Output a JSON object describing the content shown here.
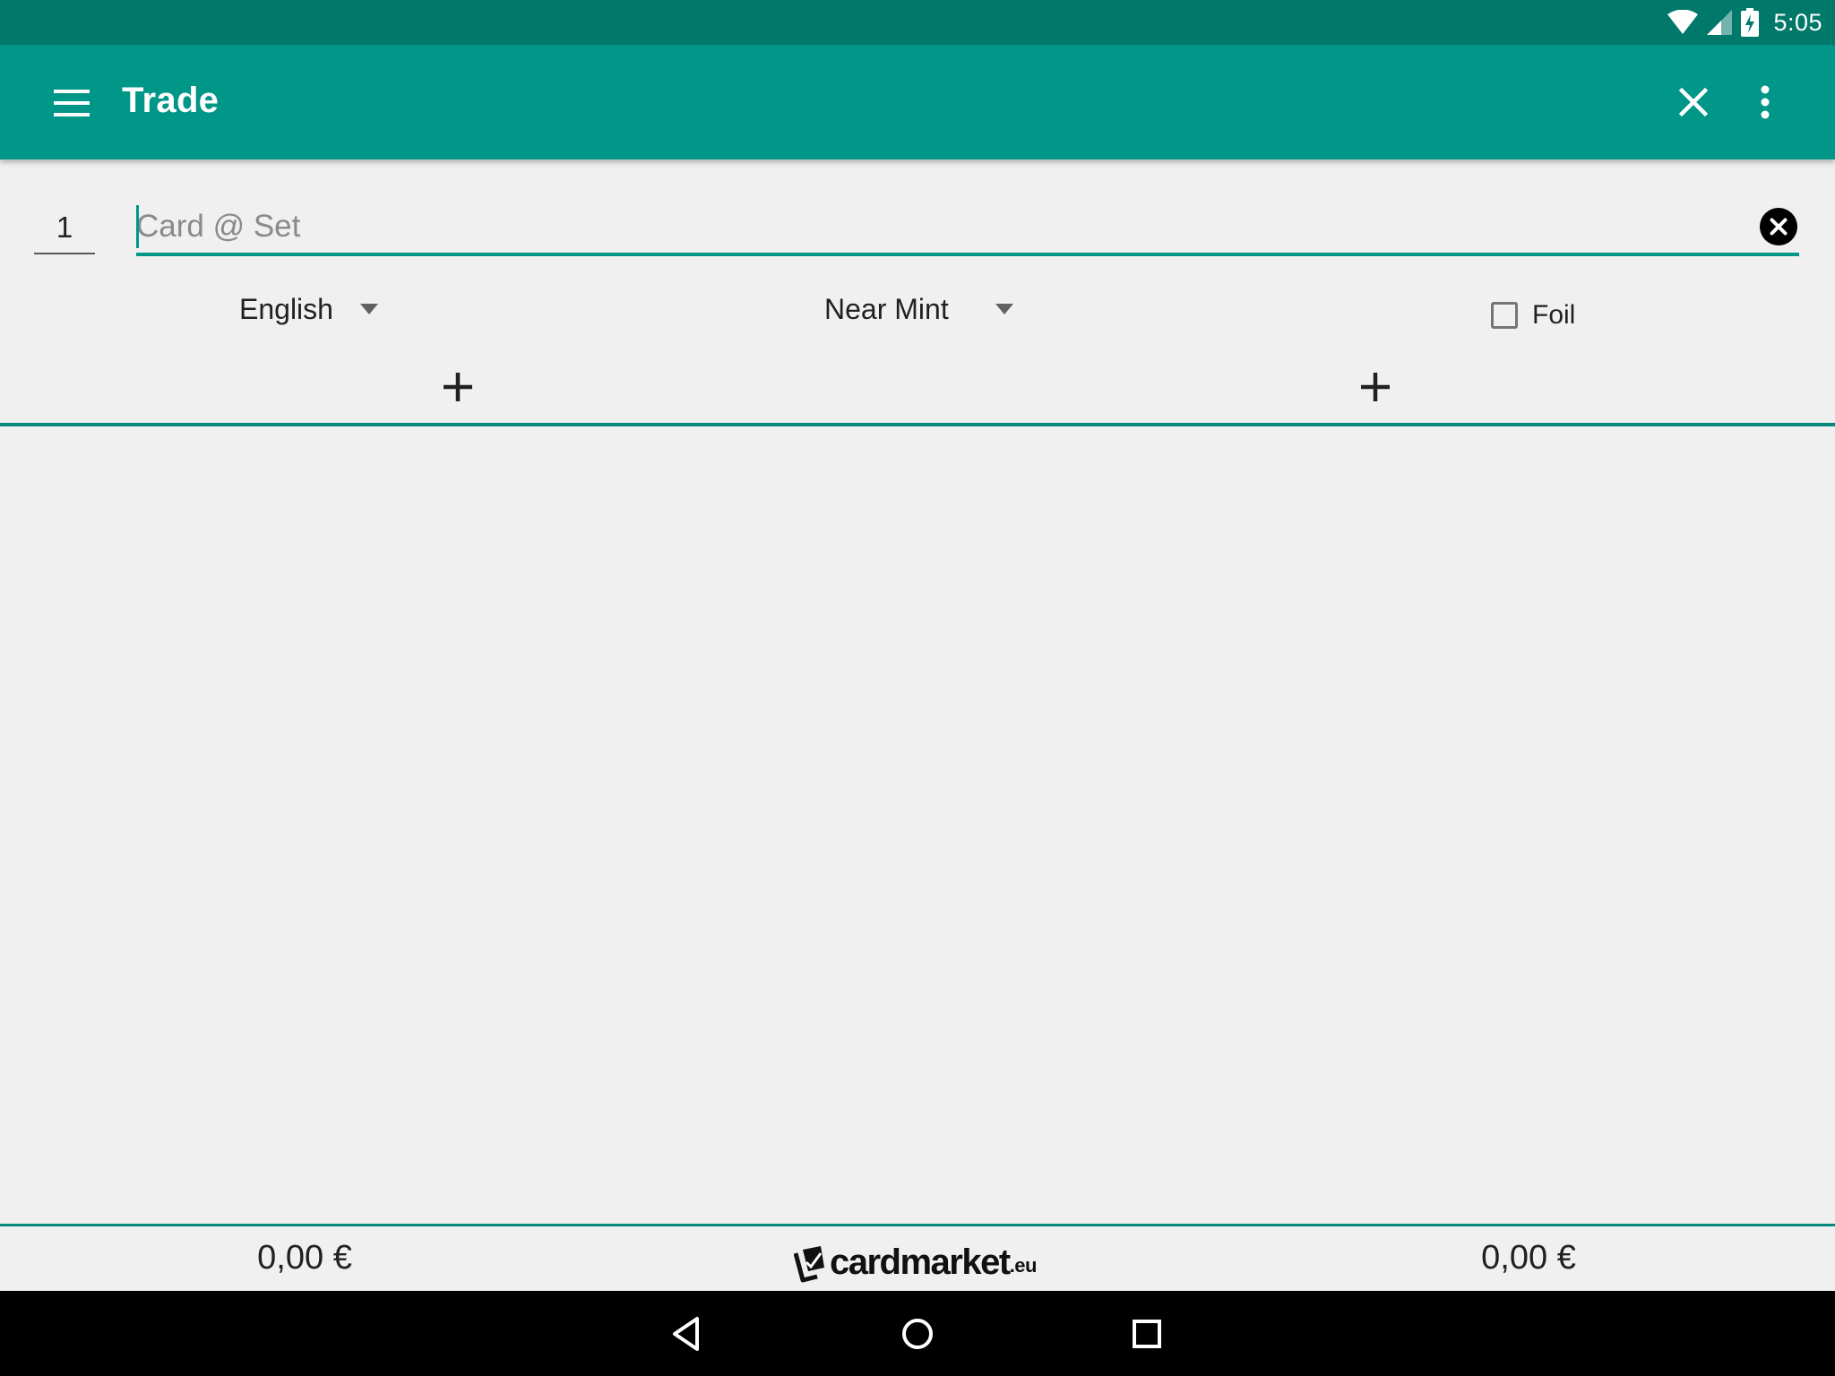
{
  "status_bar": {
    "time": "5:05"
  },
  "app_bar": {
    "title": "Trade"
  },
  "form": {
    "quantity": "1",
    "card_placeholder": "Card @ Set",
    "card_value": "",
    "language": "English",
    "condition": "Near Mint",
    "foil_label": "Foil",
    "foil_checked": false
  },
  "footer": {
    "left_total": "0,00 €",
    "right_total": "0,00 €",
    "logo_main": "cardmarket",
    "logo_sub": ".eu"
  },
  "colors": {
    "status_bar": "#00796b",
    "app_bar": "#009688",
    "accent": "#009688",
    "background": "#f0f0f0",
    "nav_bar": "#000000"
  },
  "icons": {
    "menu": "menu-icon",
    "close": "close-icon",
    "overflow": "more-vert-icon",
    "clear": "clear-circle-icon",
    "add": "plus-icon",
    "back": "back-triangle-icon",
    "home": "home-circle-icon",
    "recents": "recents-square-icon"
  }
}
